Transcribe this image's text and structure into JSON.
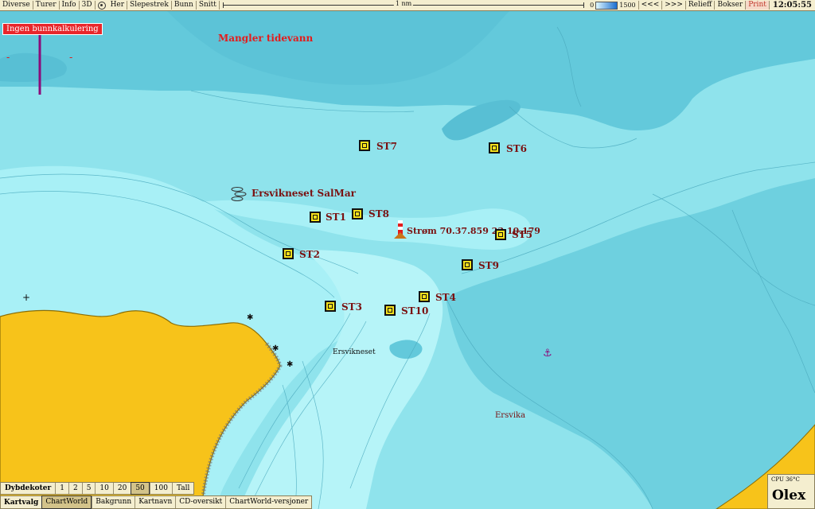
{
  "toolbar": {
    "items": [
      "Diverse",
      "Turer",
      "Info",
      "3D",
      "Her",
      "Slepestrek",
      "Bunn",
      "Snitt"
    ],
    "scale_label": "1 nm",
    "depth_min": "0",
    "depth_max": "1500",
    "nav_prev": "<<<",
    "nav_next": ">>>",
    "relieff": "Relieff",
    "bokser": "Bokser",
    "print": "Print",
    "clock": "12:05:55"
  },
  "map": {
    "warning": "Ingen bunnkalkulering",
    "tide_warning": "Mangler tidevann",
    "fish_farm": "Ersvikneset SalMar",
    "current_label": "Strøm  70.37.859 23.10.179",
    "place_ersvikneset": "Ersvikneset",
    "place_ersvika": "Ersvika",
    "stations": [
      "ST1",
      "ST2",
      "ST3",
      "ST4",
      "ST5",
      "ST6",
      "ST7",
      "ST8",
      "ST9",
      "ST10"
    ]
  },
  "dybdekoter": {
    "title": "Dybdekoter",
    "options": [
      "1",
      "2",
      "5",
      "10",
      "20",
      "50",
      "100",
      "Tall"
    ],
    "selected": "50"
  },
  "kartvalg": {
    "title": "Kartvalg",
    "options": [
      "ChartWorld",
      "Bakgrunn",
      "Kartnavn",
      "CD-oversikt",
      "ChartWorld-versjoner"
    ],
    "selected": "ChartWorld"
  },
  "status": {
    "cpu": "CPU 36°C",
    "brand": "Olex"
  },
  "colors": {
    "land": "#f7c31a",
    "shallow": "#a8f0f6",
    "mid": "#8fe3ec",
    "deep": "#63c9db",
    "label_red": "#7a1212",
    "warning_red": "#e8262b"
  }
}
